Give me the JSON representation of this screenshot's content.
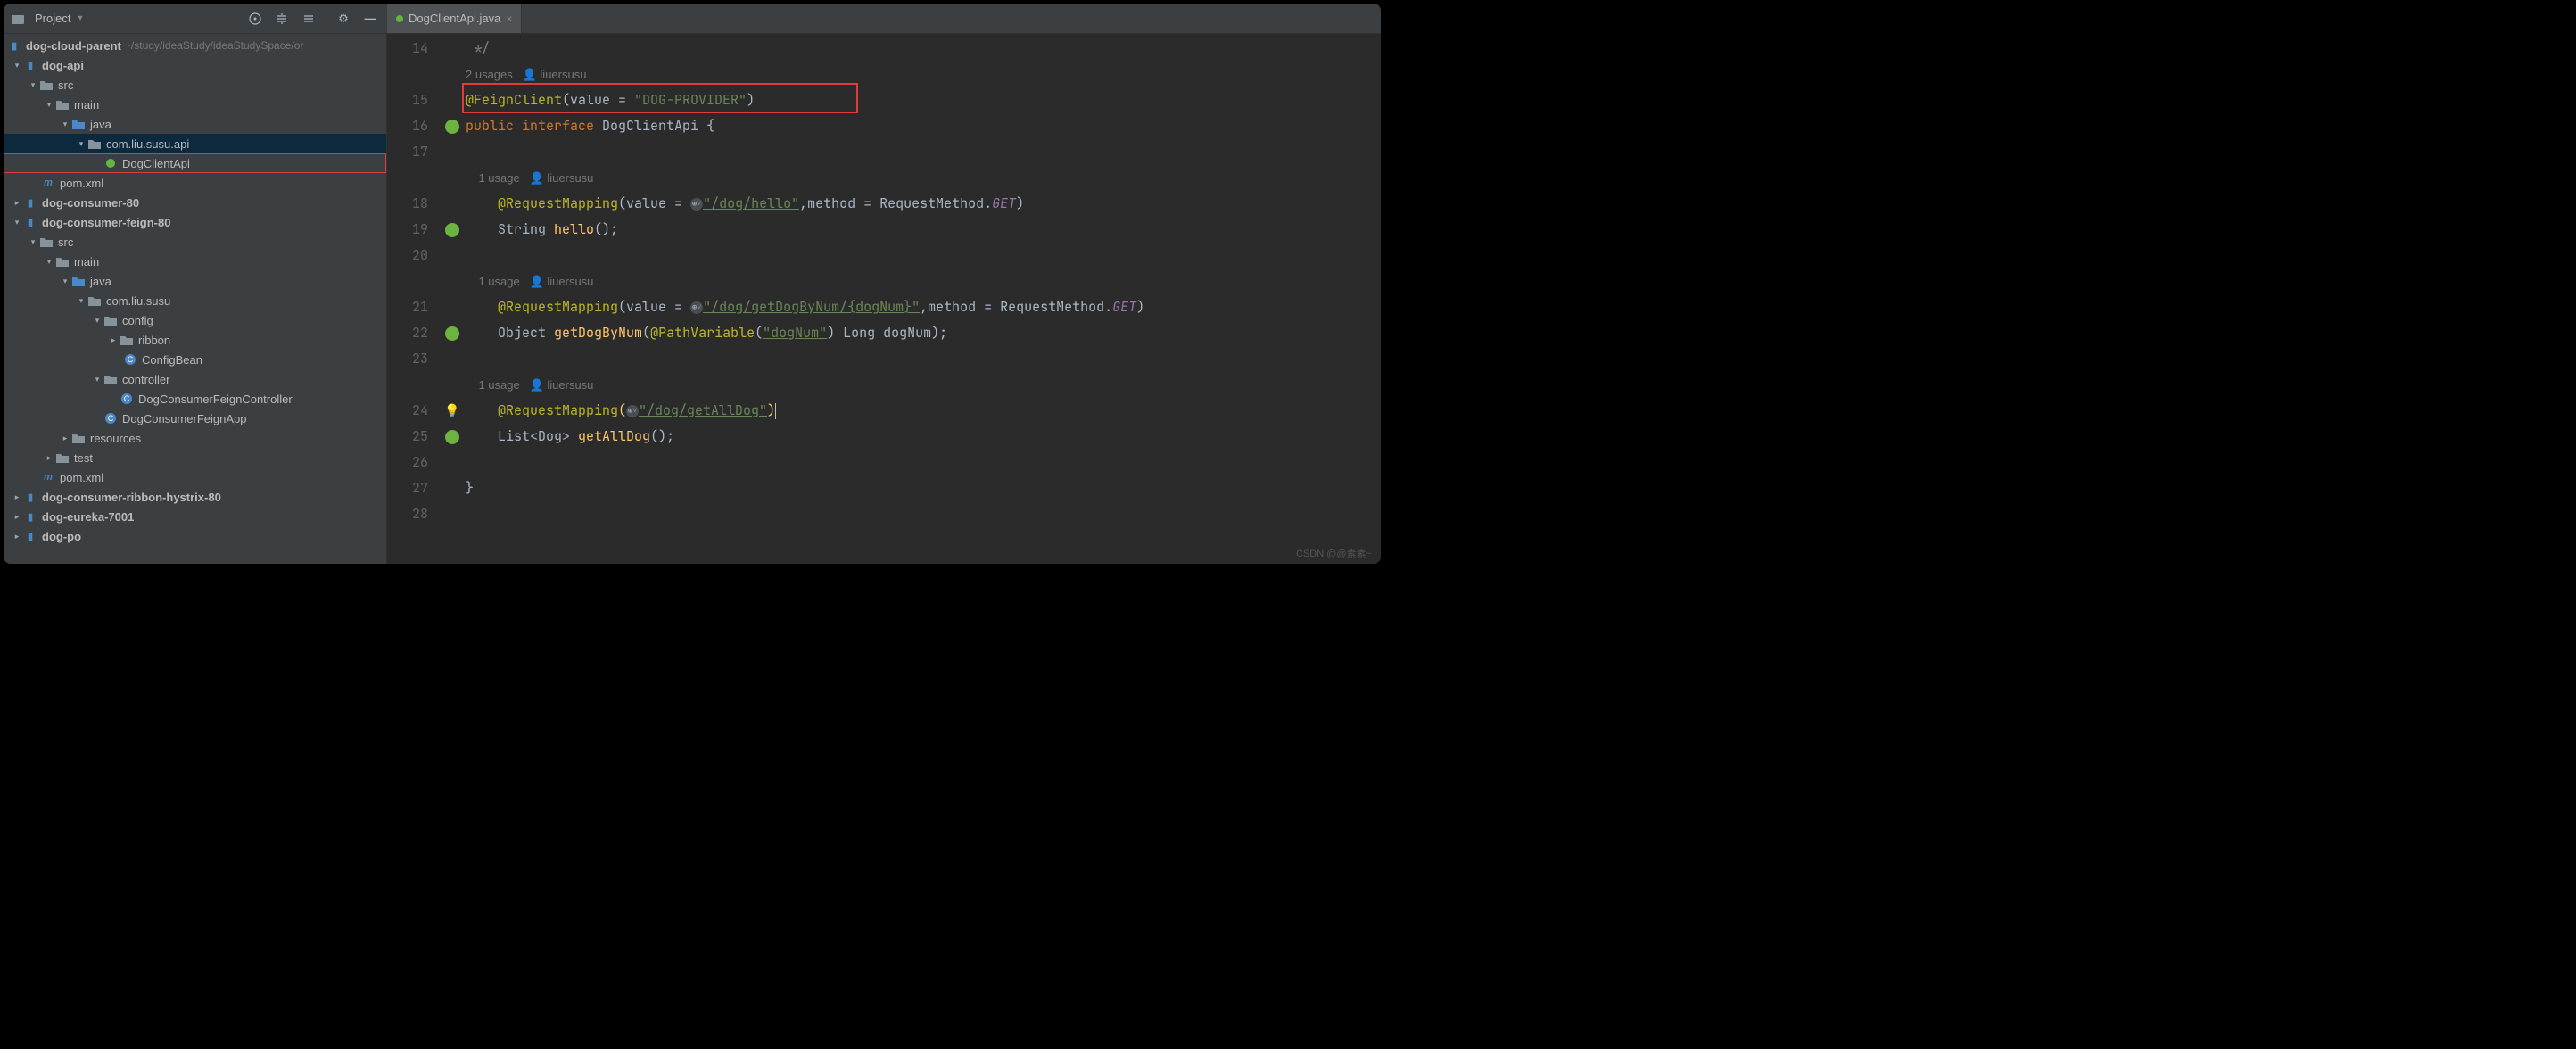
{
  "titlebar": {
    "project_label": "Project"
  },
  "tab": {
    "filename": "DogClientApi.java"
  },
  "tree": {
    "root": {
      "name": "dog-cloud-parent",
      "path": "~/study/ideaStudy/ideaStudySpace/or"
    },
    "dog_api": "dog-api",
    "src1": "src",
    "main1": "main",
    "java1": "java",
    "pkg1": "com.liu.susu.api",
    "file1": "DogClientApi",
    "pom1": "pom.xml",
    "dog_consumer_80": "dog-consumer-80",
    "dog_consumer_feign_80": "dog-consumer-feign-80",
    "src2": "src",
    "main2": "main",
    "java2": "java",
    "pkg2": "com.liu.susu",
    "config": "config",
    "ribbon": "ribbon",
    "configbean": "ConfigBean",
    "controller": "controller",
    "feignctrl": "DogConsumerFeignController",
    "feignapp": "DogConsumerFeignApp",
    "resources": "resources",
    "test": "test",
    "pom2": "pom.xml",
    "ribbon_hystrix": "dog-consumer-ribbon-hystrix-80",
    "eureka": "dog-eureka-7001",
    "dog_po": "dog-po"
  },
  "code": {
    "ln14": "14",
    "ln15": "15",
    "ln16": "16",
    "ln17": "17",
    "ln18": "18",
    "ln19": "19",
    "ln20": "20",
    "ln21": "21",
    "ln22": "22",
    "ln23": "23",
    "ln24": "24",
    "ln25": "25",
    "ln26": "26",
    "ln27": "27",
    "ln28": "28",
    "comment_end": " */",
    "usages2": "2 usages   ",
    "author": "liuersusu",
    "feign_ann": "@FeignClient",
    "feign_open": "(",
    "value_eq": "value = ",
    "dog_provider": "\"DOG-PROVIDER\"",
    "feign_close": ")",
    "public": "public ",
    "interface": "interface ",
    "cls": "DogClientApi ",
    "brace_o": "{",
    "usage1a": "1 usage   ",
    "reqmap": "@RequestMapping",
    "rm_open": "(",
    "url_hello": "\"/dog/hello\"",
    "method_eq": ",method = RequestMethod.",
    "get": "GET",
    "rm_close": ")",
    "string_t": "String ",
    "hello_m": "hello",
    "hello_p": "();",
    "url_getdog": "\"/dog/getDogByNum/{dogNum}\"",
    "object_t": "Object ",
    "getdog_m": "getDogByNum",
    "getdog_open": "(",
    "pathvar": "@PathVariable",
    "pathvar_open": "(",
    "dognum_str": "\"dogNum\"",
    "pathvar_close": ") ",
    "long_t": "Long ",
    "dognum_p": "dogNum",
    "getdog_close": ");",
    "url_getall": "\"/dog/getAllDog\"",
    "rm_close2": ")",
    "list_t": "List",
    "dog_gen": "<Dog> ",
    "getall_m": "getAllDog",
    "getall_p": "();",
    "brace_c": "}"
  },
  "watermark": "CSDN @@素素~"
}
